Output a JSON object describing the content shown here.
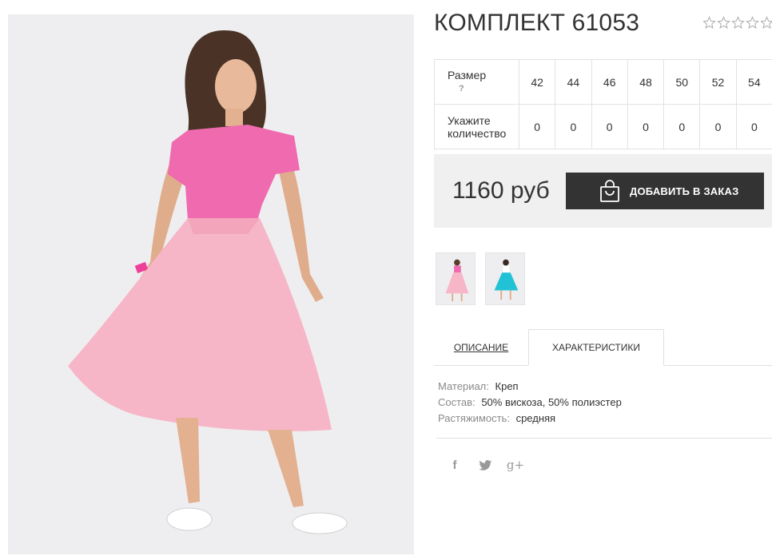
{
  "product": {
    "title": "КОМПЛЕКТ 61053",
    "rating": 0,
    "rating_max": 5
  },
  "size_table": {
    "size_label": "Размер",
    "help_mark": "?",
    "qty_label_line1": "Укажите",
    "qty_label_line2": "количество",
    "sizes": [
      "42",
      "44",
      "46",
      "48",
      "50",
      "52",
      "54"
    ],
    "quantities": [
      "0",
      "0",
      "0",
      "0",
      "0",
      "0",
      "0"
    ]
  },
  "purchase": {
    "price": "1160 руб",
    "add_button_label": "ДОБАВИТЬ В ЗАКАЗ"
  },
  "gallery": {
    "thumbnails": [
      {
        "icon": "pink-dress-thumbnail"
      },
      {
        "icon": "turquoise-skirt-thumbnail"
      }
    ]
  },
  "tabs": {
    "description": "ОПИСАНИЕ",
    "characteristics": "ХАРАКТЕРИСТИКИ",
    "active": "characteristics"
  },
  "specs": [
    {
      "key": "Материал:",
      "value": "Креп"
    },
    {
      "key": "Состав:",
      "value": "50% вискоза, 50% полиэстер"
    },
    {
      "key": "Растяжимость:",
      "value": "средняя"
    }
  ],
  "social": {
    "facebook": "f",
    "googleplus": "g+"
  },
  "colors": {
    "button_bg": "#333333",
    "price_box_bg": "#f0f0f0",
    "top_pink": "#f06ab0",
    "skirt_pink": "#f7b6c8",
    "turquoise": "#22c2d6"
  }
}
